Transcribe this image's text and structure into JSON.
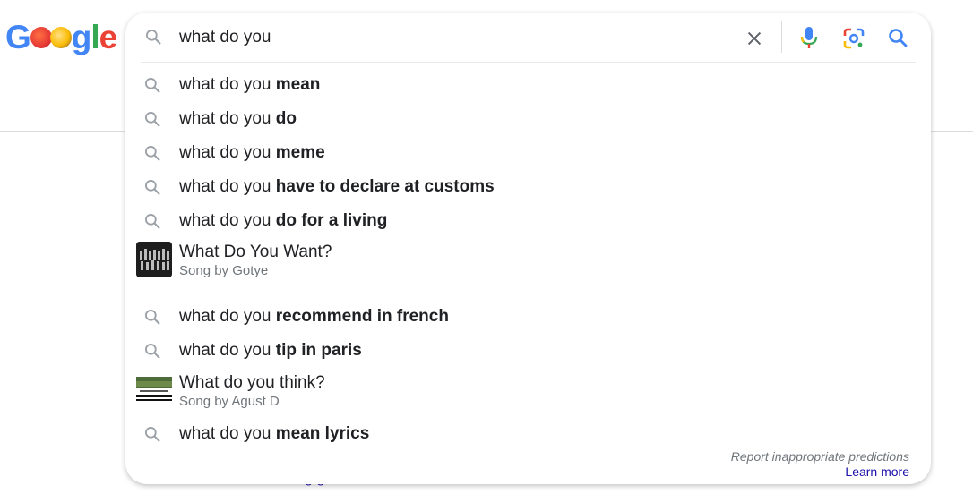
{
  "logo": {
    "text": "Google"
  },
  "search": {
    "query": "what do you",
    "clear_icon": "close-icon",
    "voice_icon": "mic-icon",
    "lens_icon": "lens-icon",
    "search_icon": "search-icon"
  },
  "suggestions": [
    {
      "type": "query",
      "prefix": "what do you ",
      "bold": "mean"
    },
    {
      "type": "query",
      "prefix": "what do you ",
      "bold": "do"
    },
    {
      "type": "query",
      "prefix": "what do you ",
      "bold": "meme"
    },
    {
      "type": "query",
      "prefix": "what do you ",
      "bold": "have to declare at customs"
    },
    {
      "type": "query",
      "prefix": "what do you ",
      "bold": "do for a living"
    },
    {
      "type": "entity",
      "title": "What Do You Want?",
      "subtitle": "Song by Gotye"
    },
    {
      "type": "query",
      "prefix": "what do you ",
      "bold": "recommend in french"
    },
    {
      "type": "query",
      "prefix": "what do you ",
      "bold": "tip in paris"
    },
    {
      "type": "entity",
      "title": "What do you think?",
      "subtitle": "Song by Agust D"
    },
    {
      "type": "query",
      "prefix": "what do you ",
      "bold": "mean lyrics"
    }
  ],
  "footer": {
    "report": "Report inappropriate predictions",
    "learn_more": "Learn more"
  },
  "colors": {
    "google_blue": "#4285f4",
    "google_red": "#ea4335",
    "google_yellow": "#fbbc05",
    "google_green": "#34a853",
    "link": "#1a0dab"
  }
}
